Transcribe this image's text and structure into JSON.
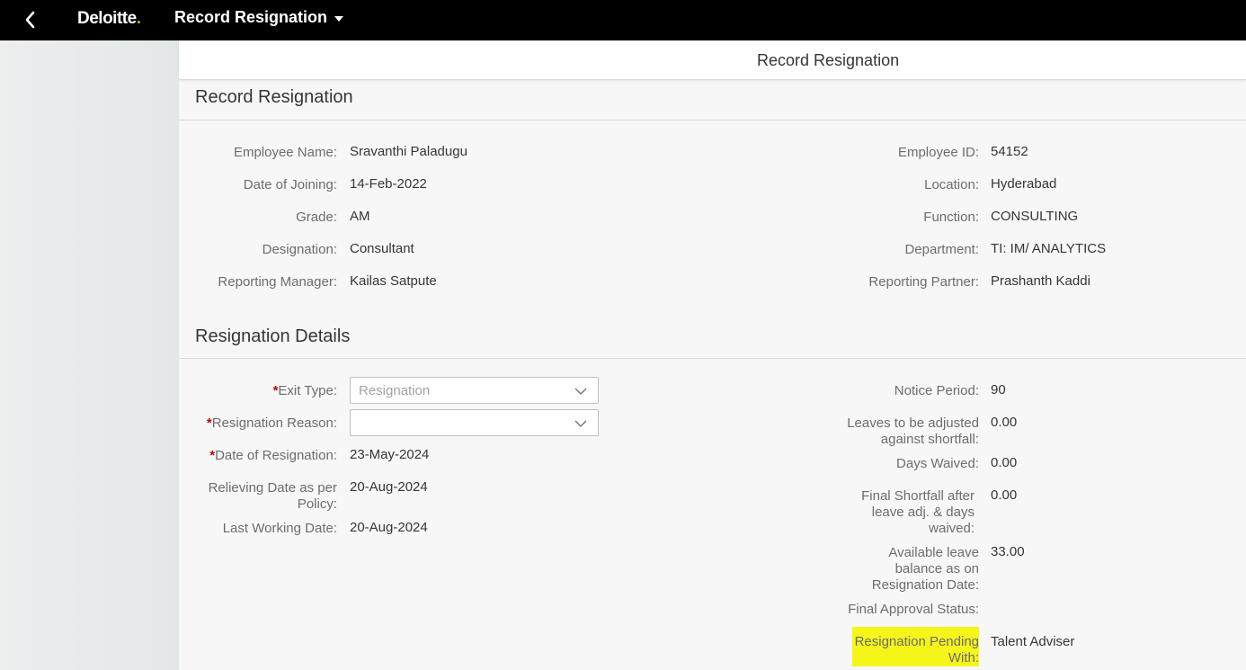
{
  "shell": {
    "brand": "Deloitte",
    "brand_dot": ".",
    "app_title": "Record Resignation"
  },
  "page": {
    "header_title": "Record Resignation"
  },
  "employee_section": {
    "title": "Record Resignation",
    "left": [
      {
        "label": "Employee Name:",
        "value": "Sravanthi Paladugu"
      },
      {
        "label": "Date of Joining:",
        "value": "14-Feb-2022"
      },
      {
        "label": "Grade:",
        "value": "AM"
      },
      {
        "label": "Designation:",
        "value": "Consultant"
      },
      {
        "label": "Reporting Manager:",
        "value": "Kailas Satpute"
      }
    ],
    "right": [
      {
        "label": "Employee ID:",
        "value": "54152"
      },
      {
        "label": "Location:",
        "value": "Hyderabad"
      },
      {
        "label": "Function:",
        "value": "CONSULTING"
      },
      {
        "label": "Department:",
        "value": "TI: IM/ ANALYTICS"
      },
      {
        "label": "Reporting Partner:",
        "value": "Prashanth Kaddi"
      }
    ]
  },
  "resignation_section": {
    "title": "Resignation Details",
    "required_marker": "*",
    "exit_type": {
      "label": "Exit Type:",
      "value": "Resignation"
    },
    "resignation_reason": {
      "label": "Resignation Reason:",
      "value": ""
    },
    "date_of_resignation": {
      "label": "Date of Resignation:",
      "value": "23-May-2024"
    },
    "relieving_date_line1": "Relieving Date as per",
    "relieving_date_line2": "Policy:",
    "relieving_date_value": "20-Aug-2024",
    "last_working_date": {
      "label": "Last Working Date:",
      "value": "20-Aug-2024"
    },
    "notice_period": {
      "label": "Notice Period:",
      "value": "90"
    },
    "leaves_adjusted_line1": "Leaves to be adjusted",
    "leaves_adjusted_line2": "against shortfall:",
    "leaves_adjusted_value": "0.00",
    "days_waived": {
      "label": "Days Waived:",
      "value": "0.00"
    },
    "final_shortfall_line1": "Final Shortfall after",
    "final_shortfall_line2": "leave adj. & days",
    "final_shortfall_line3": "waived:",
    "final_shortfall_value": "0.00",
    "available_leave_line1": "Available leave",
    "available_leave_line2": "balance as on",
    "available_leave_line3": "Resignation Date:",
    "available_leave_value": "33.00",
    "final_approval_status": {
      "label": "Final Approval Status:",
      "value": ""
    },
    "pending_with_line1": "Resignation Pending",
    "pending_with_line2": "With:",
    "pending_with_value": "Talent Adviser",
    "highlight_color": "#f5f51a"
  }
}
